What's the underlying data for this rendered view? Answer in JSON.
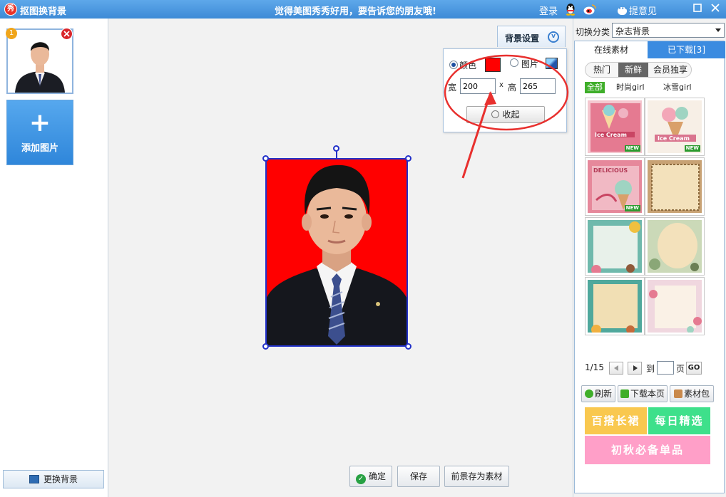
{
  "titlebar": {
    "app_logo": "秀",
    "app_title": "抠图换背景",
    "slogan": "觉得美图秀秀好用，要告诉您的朋友哦!",
    "login": "登录",
    "feedback": "提意见",
    "icons": [
      "qq-icon",
      "weibo-icon",
      "feedback-icon",
      "minimize-icon",
      "close-icon"
    ]
  },
  "left_panel": {
    "thumbnail_number": "1",
    "add_button_label": "添加图片",
    "change_bg_label": "更换背景"
  },
  "bg_settings": {
    "tab_label": "背景设置",
    "color_label": "颜色",
    "image_label": "图片",
    "selected": "颜色",
    "color": "#ff0000",
    "width_label": "宽",
    "x_label": "x",
    "height_label": "高",
    "width_value": "200",
    "height_value": "265",
    "collapse_label": "收起"
  },
  "bottom_buttons": {
    "confirm": "确定",
    "save": "保存",
    "save_foreground": "前景存为素材"
  },
  "right_panel": {
    "category_label": "切换分类",
    "category_value": "杂志背景",
    "tabs": [
      {
        "label": "在线素材",
        "active": true
      },
      {
        "label": "已下载[3]",
        "active": false
      }
    ],
    "sub_tabs": [
      {
        "label": "热门",
        "selected": false
      },
      {
        "label": "新鲜",
        "selected": true
      },
      {
        "label": "会员独享",
        "selected": false
      }
    ],
    "filters": [
      {
        "label": "全部",
        "selected": true
      },
      {
        "label": "时尚girl",
        "selected": false
      },
      {
        "label": "冰雪girl",
        "selected": false
      }
    ],
    "templates": [
      {
        "badge": "NEW",
        "text": "Ice Cream"
      },
      {
        "badge": "NEW",
        "text": "Ice Cream"
      },
      {
        "badge": "NEW",
        "text": "DELICIOUS"
      },
      {
        "badge": "",
        "text": ""
      },
      {
        "badge": "",
        "text": ""
      },
      {
        "badge": "",
        "text": ""
      },
      {
        "badge": "",
        "text": ""
      },
      {
        "badge": "",
        "text": ""
      }
    ],
    "pager": {
      "page_info": "1/15",
      "goto_label": "到",
      "page_label": "页",
      "go": "GO"
    },
    "tool_buttons": [
      "刷新",
      "下载本页",
      "素材包"
    ],
    "promos": [
      "百搭长裙",
      "每日精选",
      "初秋必备单品"
    ],
    "colors": {
      "accent_blue": "#3b8be0",
      "promo_yellow": "#f9c84f",
      "promo_green": "#3ee08b",
      "promo_pink": "#ff9fc8",
      "filter_green": "#3fae2a"
    }
  }
}
